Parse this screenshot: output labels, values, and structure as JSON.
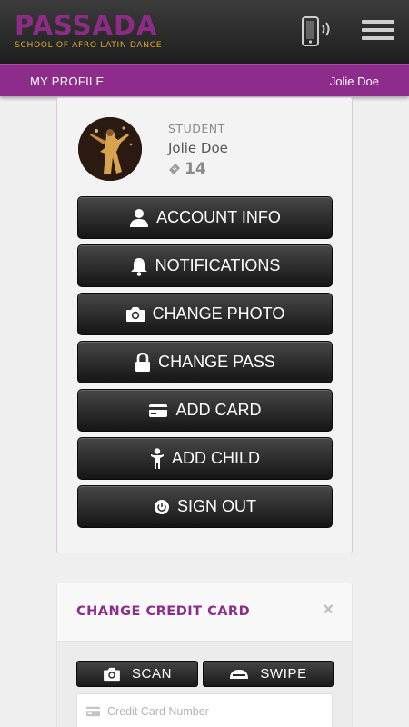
{
  "header": {
    "logo_word": "PASSADA",
    "logo_tagline": "SCHOOL OF AFRO LATIN DANCE",
    "icons": [
      "phone-vibrate-icon",
      "hamburger-menu-icon"
    ]
  },
  "subbar": {
    "title": "MY PROFILE",
    "user_name": "Jolie Doe"
  },
  "profile": {
    "role": "STUDENT",
    "name": "Jolie Doe",
    "points": "14"
  },
  "actions": [
    {
      "label": "ACCOUNT INFO",
      "icon": "user-icon"
    },
    {
      "label": "NOTIFICATIONS",
      "icon": "bell-icon"
    },
    {
      "label": "CHANGE PHOTO",
      "icon": "camera-icon"
    },
    {
      "label": "CHANGE PASS",
      "icon": "lock-icon"
    },
    {
      "label": "ADD CARD",
      "icon": "credit-card-icon"
    },
    {
      "label": "ADD CHILD",
      "icon": "child-icon"
    },
    {
      "label": "SIGN OUT",
      "icon": "power-icon"
    }
  ],
  "credit_card": {
    "title": "CHANGE CREDIT CARD",
    "close": "×",
    "scan_label": "SCAN",
    "swipe_label": "SWIPE",
    "number_placeholder": "Credit Card Number"
  },
  "colors": {
    "brand_purple": "#8e2c8c",
    "brand_gold": "#d9a82f",
    "header_dark": "#2a2a2a"
  }
}
